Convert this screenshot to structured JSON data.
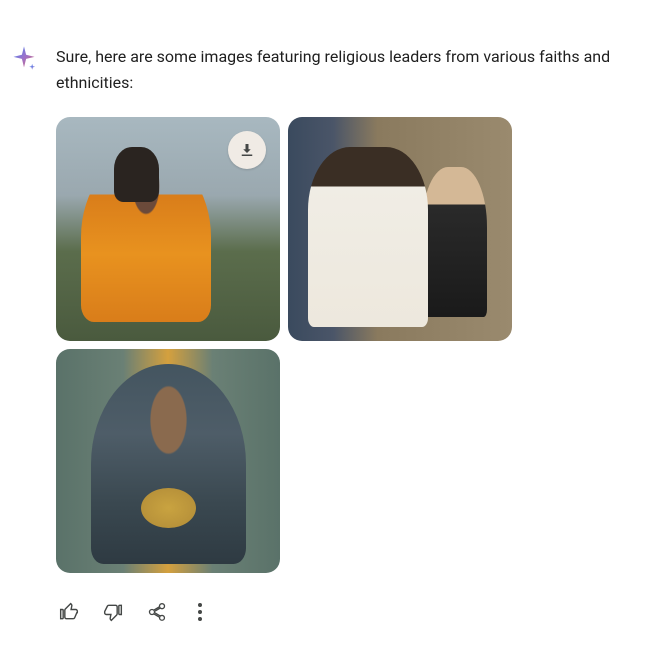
{
  "response": {
    "text": "Sure, here are some images featuring religious leaders from various faiths and ethnicities:"
  },
  "images": [
    {
      "alt": "woman-meditating-orange-robe-mountain"
    },
    {
      "alt": "priest-blessing-congregation-church"
    },
    {
      "alt": "woman-hijab-eyes-closed-ornate-background"
    }
  ],
  "actions": {
    "thumbs_up": "thumbs-up",
    "thumbs_down": "thumbs-down",
    "share": "share",
    "more": "more-options",
    "download": "download"
  }
}
